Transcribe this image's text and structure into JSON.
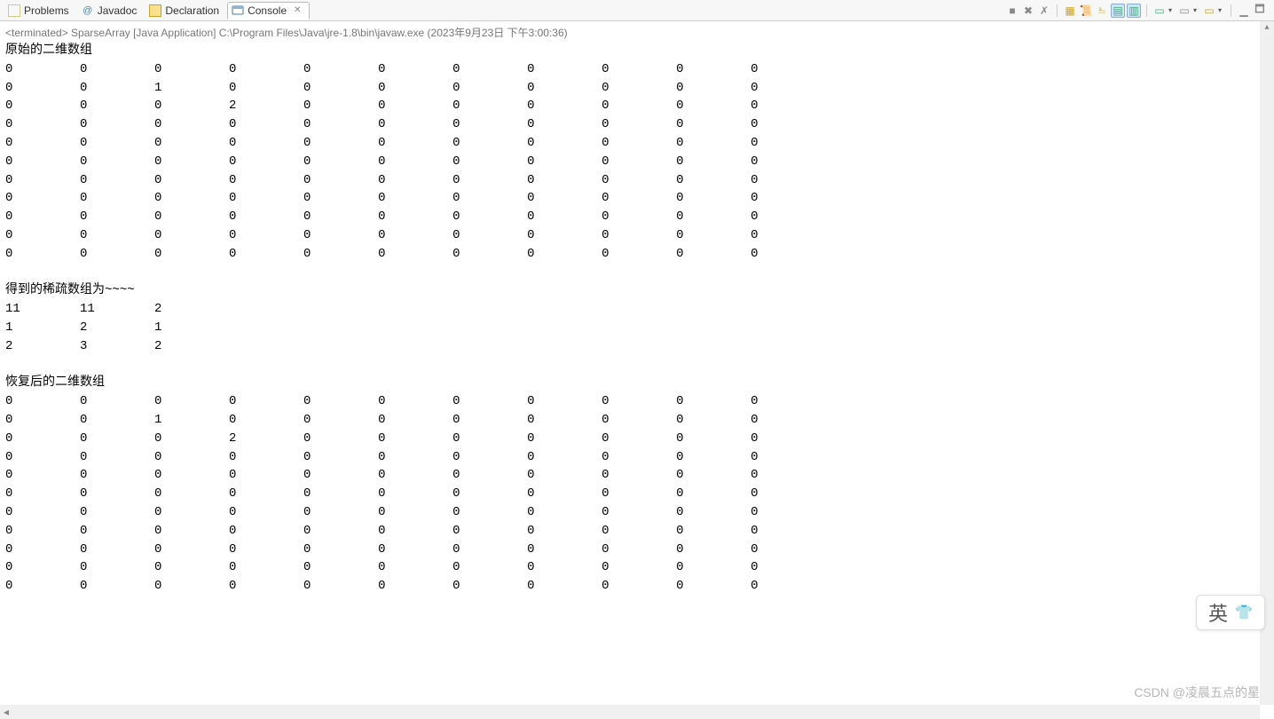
{
  "tabs": [
    {
      "icon": "problems-icon",
      "label": "Problems"
    },
    {
      "icon": "javadoc-icon",
      "label": "Javadoc"
    },
    {
      "icon": "declaration-icon",
      "label": "Declaration"
    },
    {
      "icon": "console-icon",
      "label": "Console",
      "active": true
    }
  ],
  "status_line": "<terminated> SparseArray [Java Application] C:\\Program Files\\Java\\jre-1.8\\bin\\javaw.exe (2023年9月23日 下午3:00:36)",
  "console": {
    "header_original": "原始的二维数组",
    "original_array": [
      [
        0,
        0,
        0,
        0,
        0,
        0,
        0,
        0,
        0,
        0,
        0
      ],
      [
        0,
        0,
        1,
        0,
        0,
        0,
        0,
        0,
        0,
        0,
        0
      ],
      [
        0,
        0,
        0,
        2,
        0,
        0,
        0,
        0,
        0,
        0,
        0
      ],
      [
        0,
        0,
        0,
        0,
        0,
        0,
        0,
        0,
        0,
        0,
        0
      ],
      [
        0,
        0,
        0,
        0,
        0,
        0,
        0,
        0,
        0,
        0,
        0
      ],
      [
        0,
        0,
        0,
        0,
        0,
        0,
        0,
        0,
        0,
        0,
        0
      ],
      [
        0,
        0,
        0,
        0,
        0,
        0,
        0,
        0,
        0,
        0,
        0
      ],
      [
        0,
        0,
        0,
        0,
        0,
        0,
        0,
        0,
        0,
        0,
        0
      ],
      [
        0,
        0,
        0,
        0,
        0,
        0,
        0,
        0,
        0,
        0,
        0
      ],
      [
        0,
        0,
        0,
        0,
        0,
        0,
        0,
        0,
        0,
        0,
        0
      ],
      [
        0,
        0,
        0,
        0,
        0,
        0,
        0,
        0,
        0,
        0,
        0
      ]
    ],
    "header_sparse": "得到的稀疏数组为~~~~",
    "sparse_array": [
      [
        11,
        11,
        2
      ],
      [
        1,
        2,
        1
      ],
      [
        2,
        3,
        2
      ]
    ],
    "header_restored": "恢复后的二维数组",
    "restored_array": [
      [
        0,
        0,
        0,
        0,
        0,
        0,
        0,
        0,
        0,
        0,
        0
      ],
      [
        0,
        0,
        1,
        0,
        0,
        0,
        0,
        0,
        0,
        0,
        0
      ],
      [
        0,
        0,
        0,
        2,
        0,
        0,
        0,
        0,
        0,
        0,
        0
      ],
      [
        0,
        0,
        0,
        0,
        0,
        0,
        0,
        0,
        0,
        0,
        0
      ],
      [
        0,
        0,
        0,
        0,
        0,
        0,
        0,
        0,
        0,
        0,
        0
      ],
      [
        0,
        0,
        0,
        0,
        0,
        0,
        0,
        0,
        0,
        0,
        0
      ],
      [
        0,
        0,
        0,
        0,
        0,
        0,
        0,
        0,
        0,
        0,
        0
      ],
      [
        0,
        0,
        0,
        0,
        0,
        0,
        0,
        0,
        0,
        0,
        0
      ],
      [
        0,
        0,
        0,
        0,
        0,
        0,
        0,
        0,
        0,
        0,
        0
      ],
      [
        0,
        0,
        0,
        0,
        0,
        0,
        0,
        0,
        0,
        0,
        0
      ],
      [
        0,
        0,
        0,
        0,
        0,
        0,
        0,
        0,
        0,
        0,
        0
      ]
    ]
  },
  "ime": {
    "mode": "英"
  },
  "watermark": "CSDN @凌晨五点的星",
  "toolbar_icons": [
    "terminate-icon",
    "remove-launch-icon",
    "remove-all-icon",
    "sep",
    "clear-console-icon",
    "scroll-lock-icon",
    "word-wrap-icon",
    "show-console-icon",
    "pin-console-icon",
    "sep",
    "display-selected-icon",
    "open-console-icon",
    "new-console-icon",
    "sep",
    "minimize-icon",
    "maximize-icon"
  ]
}
